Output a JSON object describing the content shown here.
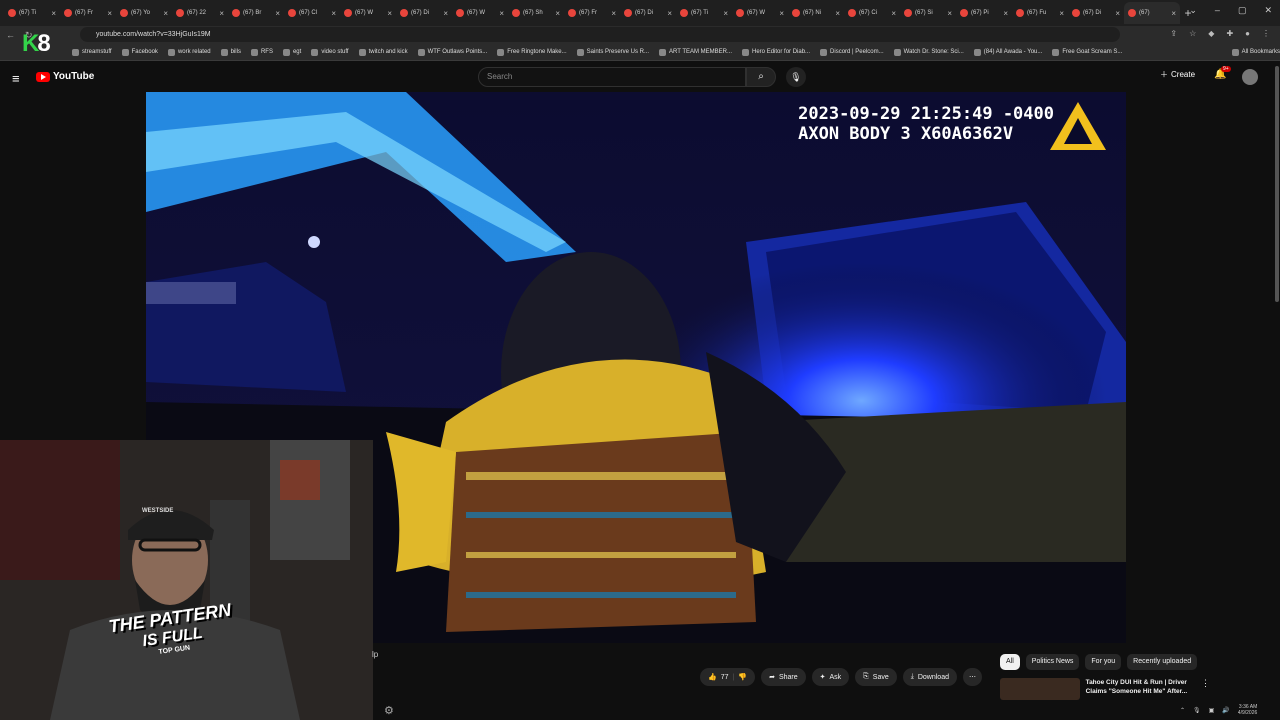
{
  "tabs": [
    {
      "label": "(67) Ti"
    },
    {
      "label": "(67) Fr"
    },
    {
      "label": "(67) Yo"
    },
    {
      "label": "(67) 22"
    },
    {
      "label": "(67) Br"
    },
    {
      "label": "(67) Cl"
    },
    {
      "label": "(67) W"
    },
    {
      "label": "(67) Di"
    },
    {
      "label": "(67) W"
    },
    {
      "label": "(67) Sh"
    },
    {
      "label": "(67) Fr"
    },
    {
      "label": "(67) Di"
    },
    {
      "label": "(67) Ti"
    },
    {
      "label": "(67) W"
    },
    {
      "label": "(67) Ni"
    },
    {
      "label": "(67) Ci"
    },
    {
      "label": "(67) Si"
    },
    {
      "label": "(67) Pi"
    },
    {
      "label": "(67) Fu"
    },
    {
      "label": "(67) Di"
    },
    {
      "label": "(67)"
    }
  ],
  "address": {
    "url": "youtube.com/watch?v=33HjGuIs19M"
  },
  "bookmarks": [
    "streamstuff",
    "Facebook",
    "work related",
    "bills",
    "RFS",
    "egt",
    "video stuff",
    "twitch and kick",
    "WTF Outlaws Points...",
    "Free Ringtone Make...",
    "Saints Preserve Us R...",
    "ART TEAM MEMBER...",
    "Hero Editor for Diab...",
    "Discord | Peelcom...",
    "Watch Dr. Stone: Sci...",
    "(84) All Awada - You...",
    "Free Goat Scream S...",
    "All Bookmarks"
  ],
  "overlay": {
    "k": "K",
    "eight": "8"
  },
  "youtube": {
    "logo_text": "YouTube",
    "search_placeholder": "Search",
    "create_label": "Create",
    "notif_count": "9+"
  },
  "video": {
    "timestamp": "2023-09-29 21:25:49 -0400",
    "device": "AXON BODY 3 X60A6362V"
  },
  "webcam": {
    "beanie_text": "WESTSIDE",
    "shirt_line1": "THE PATTERN",
    "shirt_line2": "IS FULL",
    "shirt_line3": "TOP GUN"
  },
  "actions": {
    "like_count": "77",
    "share": "Share",
    "ask": "Ask",
    "save": "Save",
    "download": "Download"
  },
  "chips": [
    "All",
    "Politics News",
    "For you",
    "Recently uploaded"
  ],
  "recommended": {
    "title": "Tahoe City DUI Hit & Run | Driver Claims \"Someone Hit Me\" After..."
  },
  "taskbar": {
    "time": "3:36 AM",
    "date": "4/9/2026"
  },
  "tiny_label": "lp",
  "colors": {
    "accent": "#ff0000",
    "bg": "#0f0f0f",
    "police_blue": "#1a4cff"
  }
}
